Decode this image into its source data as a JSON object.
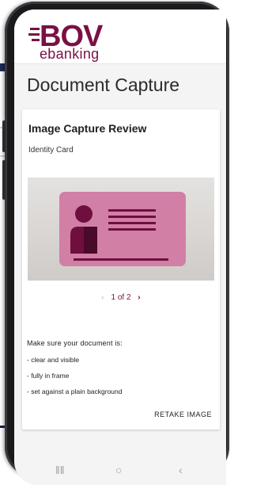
{
  "header": {
    "logo_text": "BOV",
    "logo_sub": "ebanking",
    "brand_color": "#7a1045"
  },
  "page": {
    "title": "Document Capture"
  },
  "card": {
    "title": "Image Capture Review",
    "document_type": "Identity Card",
    "pager": {
      "prev_icon": "chevron-left-icon",
      "label": "1 of 2",
      "next_icon": "chevron-right-icon"
    },
    "instructions": {
      "lead": "Make sure your document is:",
      "items": [
        "- clear and visible",
        "- fully in frame",
        "- set against a plain background"
      ]
    },
    "retake_label": "RETAKE IMAGE"
  },
  "navbar": {
    "icons": [
      "recents-icon",
      "home-icon",
      "back-icon"
    ]
  },
  "colors": {
    "accent": "#7a1045",
    "card_pink": "#d27fa6",
    "header_bg": "#ffffff",
    "screen_bg": "#f4f4f4"
  }
}
